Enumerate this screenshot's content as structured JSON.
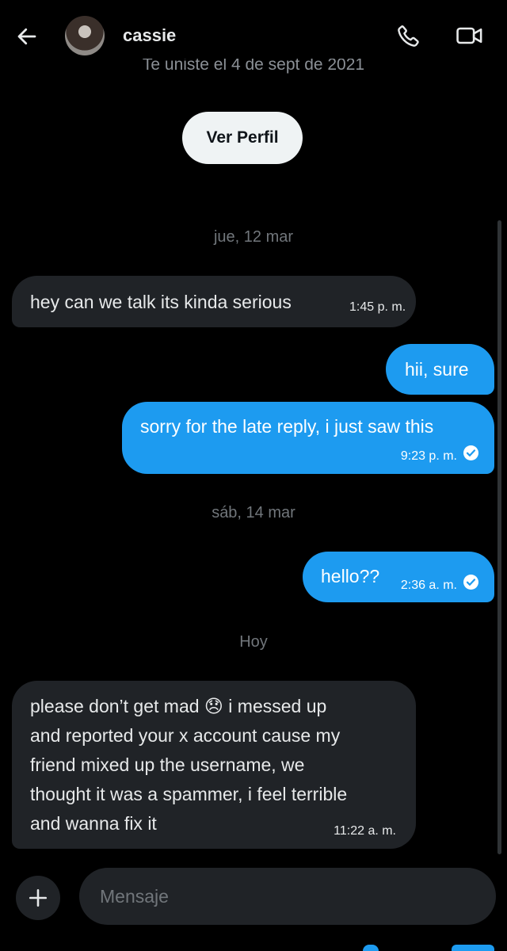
{
  "header": {
    "contact_name": "cassie",
    "joined_text": "Te uniste el 4 de sept de 2021",
    "icons": {
      "back": "arrow-left-icon",
      "call": "phone-icon",
      "video": "video-camera-icon"
    }
  },
  "profile_button": "Ver Perfil",
  "dates": {
    "first": "jue, 12 mar",
    "second": "sáb, 14 mar",
    "third": "Hoy"
  },
  "messages": [
    {
      "direction": "incoming",
      "text": "hey can we talk its kinda serious",
      "time": "1:45 p. m."
    },
    {
      "direction": "outgoing",
      "text": "hii, sure",
      "time": ""
    },
    {
      "direction": "outgoing",
      "text": "sorry for the late reply, i just saw this",
      "time": "9:23 p. m.",
      "read": true
    },
    {
      "direction": "outgoing",
      "text": "hello??",
      "time": "2:36 a. m.",
      "read": true
    },
    {
      "direction": "incoming",
      "lines": [
        "please don’t get mad 😞 i messed up",
        "and reported your x account cause my",
        "friend mixed up the username, we",
        "thought it was a spammer, i feel terrible",
        "and wanna fix it"
      ],
      "time": "11:22 a. m."
    }
  ],
  "composer": {
    "placeholder": "Mensaje",
    "add_icon": "plus-icon"
  },
  "colors": {
    "background": "#000000",
    "outgoing": "#1d9bf0",
    "incoming": "#202327"
  }
}
